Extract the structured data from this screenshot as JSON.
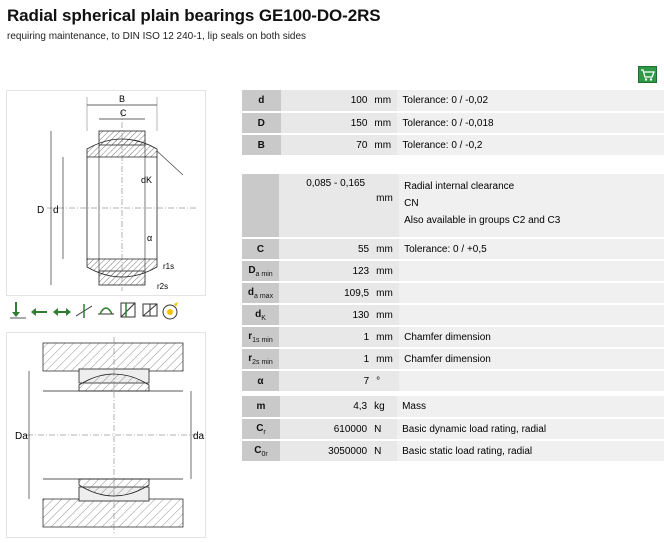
{
  "header": {
    "title": "Radial spherical plain bearings GE100-DO-2RS",
    "subtitle": "requiring maintenance, to DIN ISO 12 240-1, lip seals on both sides"
  },
  "cart_icon": "shopping-cart-icon",
  "drawing_top": {
    "label_B": "B",
    "label_C": "C",
    "label_D": "D",
    "label_d": "d",
    "label_dk": "dK",
    "label_alpha": "α",
    "label_r1s": "r1s",
    "label_r2s": "r2s"
  },
  "drawing_bottom": {
    "label_Da": "Da",
    "label_da": "da"
  },
  "load_icons": [
    "Fr-arrow-icon",
    "Fa-arrow-icon",
    "Fa-combined-arrow-icon",
    "tilting-icon",
    "alignment-icon",
    "seal-icon",
    "heat-icon"
  ],
  "table1": [
    {
      "label": "d",
      "value": "100",
      "unit": "mm",
      "desc": "Tolerance: 0 / -0,02"
    },
    {
      "label": "D",
      "value": "150",
      "unit": "mm",
      "desc": "Tolerance: 0 / -0,018"
    },
    {
      "label": "B",
      "value": "70",
      "unit": "mm",
      "desc": "Tolerance: 0 / -0,2"
    }
  ],
  "clearance": {
    "value": "0,085 - 0,165",
    "unit": "mm",
    "line1": "Radial internal clearance",
    "line2": "CN",
    "line3": "Also available in groups C2 and C3"
  },
  "table2": [
    {
      "label": "C",
      "sub": "",
      "value": "55",
      "unit": "mm",
      "desc": "Tolerance: 0 / +0,5"
    },
    {
      "label": "D",
      "sub": "a min",
      "value": "123",
      "unit": "mm",
      "desc": ""
    },
    {
      "label": "d",
      "sub": "a max",
      "value": "109,5",
      "unit": "mm",
      "desc": ""
    },
    {
      "label": "d",
      "sub": "K",
      "value": "130",
      "unit": "mm",
      "desc": ""
    },
    {
      "label": "r",
      "sub": "1s min",
      "value": "1",
      "unit": "mm",
      "desc": "Chamfer dimension"
    },
    {
      "label": "r",
      "sub": "2s min",
      "value": "1",
      "unit": "mm",
      "desc": "Chamfer dimension"
    },
    {
      "label": "α",
      "sub": "",
      "value": "7",
      "unit": "°",
      "desc": ""
    }
  ],
  "table3": [
    {
      "label": "m",
      "sub": "",
      "value": "4,3",
      "unit": "kg",
      "desc": "Mass"
    },
    {
      "label": "C",
      "sub": "r",
      "value": "610000",
      "unit": "N",
      "desc": "Basic dynamic load rating, radial"
    },
    {
      "label": "C",
      "sub": "0r",
      "value": "3050000",
      "unit": "N",
      "desc": "Basic static load rating, radial"
    }
  ]
}
